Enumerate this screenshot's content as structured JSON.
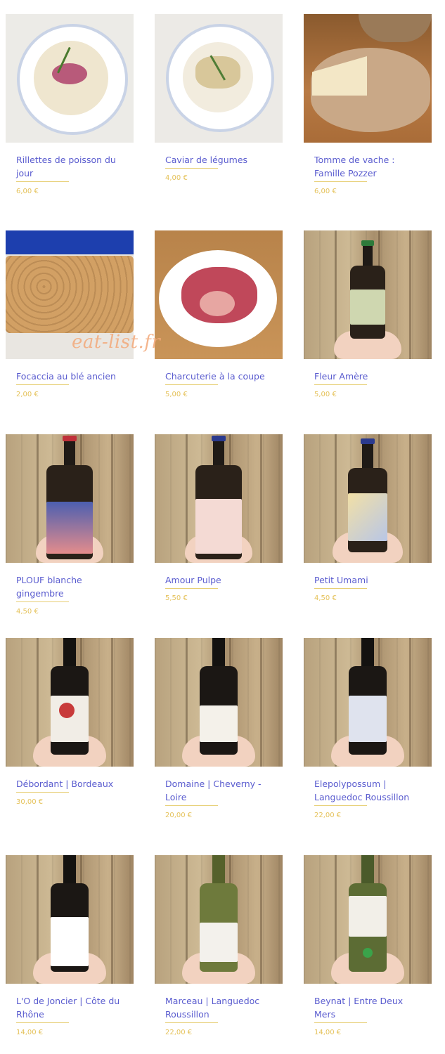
{
  "watermark": "eat-list.fr",
  "accent_colors": {
    "title": "#5a5ccf",
    "price": "#e5c25a",
    "rule": "#e7cf75"
  },
  "products": [
    {
      "name": "Rillettes de poisson du jour",
      "price": "6,00 €",
      "image": "fish-rillettes-bowl"
    },
    {
      "name": "Caviar de légumes",
      "price": "4,00 €",
      "image": "vegetable-caviar-bowl"
    },
    {
      "name": "Tomme de vache : Famille Pozzer",
      "price": "6,00 €",
      "image": "cheese-wheel"
    },
    {
      "name": "Focaccia au blé ancien",
      "price": "2,00 €",
      "image": "focaccia-bread"
    },
    {
      "name": "Charcuterie à la coupe",
      "price": "5,00 €",
      "image": "charcuterie-plate"
    },
    {
      "name": "Fleur Amère",
      "price": "5,00 €",
      "image": "beer-bottle"
    },
    {
      "name": "PLOUF blanche gingembre",
      "price": "4,50 €",
      "image": "beer-bottle"
    },
    {
      "name": "Amour Pulpe",
      "price": "5,50 €",
      "image": "beer-bottle"
    },
    {
      "name": "Petit Umami",
      "price": "4,50 €",
      "image": "beer-bottle"
    },
    {
      "name": "Débordant | Bordeaux",
      "price": "30,00 €",
      "image": "wine-bottle"
    },
    {
      "name": "Domaine | Cheverny - Loire",
      "price": "20,00 €",
      "image": "wine-bottle"
    },
    {
      "name": "Elepolypossum | Languedoc Roussillon",
      "price": "22,00 €",
      "image": "wine-bottle"
    },
    {
      "name": "L'O de Joncier | Côte du Rhône",
      "price": "14,00 €",
      "image": "wine-bottle"
    },
    {
      "name": "Marceau | Languedoc Roussillon",
      "price": "22,00 €",
      "image": "wine-bottle"
    },
    {
      "name": "Beynat | Entre Deux Mers",
      "price": "14,00 €",
      "image": "wine-bottle"
    }
  ]
}
